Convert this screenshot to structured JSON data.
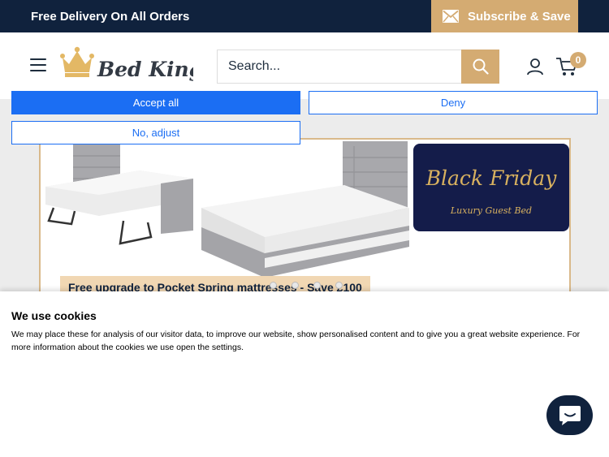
{
  "topbar": {
    "promo_text": "Free Delivery On All Orders",
    "subscribe_label": "Subscribe & Save"
  },
  "header": {
    "logo_text": "Bed Kings",
    "search_placeholder": "Search...",
    "cart_count": "0"
  },
  "banner": {
    "headline": "Black Friday",
    "subheadline": "Luxury Guest Bed",
    "offer_text": "Free upgrade to Pocket Spring mattresses - Save £100",
    "slide_count": 4
  },
  "cookie": {
    "title": "We use cookies",
    "text": "We may place these for analysis of our visitor data, to improve our website, show personalised content and to give you a great website experience. For more information about the cookies we use open the settings.",
    "accept_label": "Accept all",
    "deny_label": "Deny",
    "adjust_label": "No, adjust"
  },
  "colors": {
    "navy": "#10223d",
    "gold": "#d4ab72",
    "button_blue": "#1b6ef3"
  },
  "icons": [
    "mail-icon",
    "menu-icon",
    "crown-icon",
    "search-icon",
    "user-icon",
    "cart-icon",
    "chat-icon"
  ]
}
